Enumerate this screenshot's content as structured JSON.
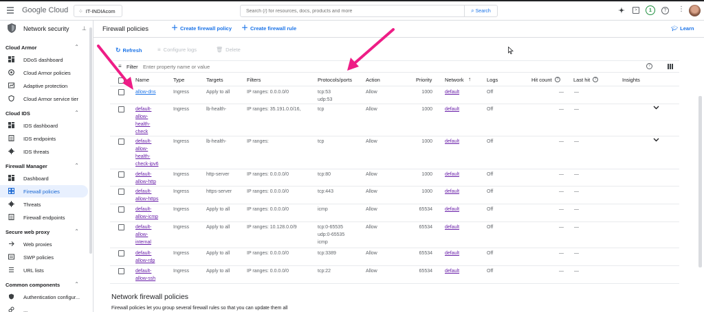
{
  "topbar": {
    "logo": "Google Cloud",
    "project": "IT-INDIAcom",
    "search_placeholder": "Search (/) for resources, docs, products and more",
    "search_button": "Search",
    "notification_count": "1"
  },
  "sidebar": {
    "title": "Network security",
    "sections": [
      {
        "header": "Cloud Armor",
        "items": [
          "DDoS dashboard",
          "Cloud Armor policies",
          "Adaptive protection",
          "Cloud Armor service tier"
        ]
      },
      {
        "header": "Cloud IDS",
        "items": [
          "IDS dashboard",
          "IDS endpoints",
          "IDS threats"
        ]
      },
      {
        "header": "Firewall Manager",
        "items": [
          "Dashboard",
          "Firewall policies",
          "Threats",
          "Firewall endpoints"
        ]
      },
      {
        "header": "Secure web proxy",
        "items": [
          "Web proxies",
          "SWP policies",
          "URL lists"
        ]
      },
      {
        "header": "Common components",
        "items": [
          "Authentication configur...",
          "..."
        ]
      }
    ]
  },
  "header": {
    "title": "Firewall policies",
    "create_policy": "Create firewall policy",
    "create_rule": "Create firewall rule",
    "learn": "Learn"
  },
  "toolbar": {
    "refresh": "Refresh",
    "configure_logs": "Configure logs",
    "delete": "Delete"
  },
  "filter": {
    "label": "Filter",
    "placeholder": "Enter property name or value"
  },
  "table": {
    "columns": [
      "Name",
      "Type",
      "Targets",
      "Filters",
      "Protocols/ports",
      "Action",
      "Priority",
      "Network",
      "Logs",
      "Hit count",
      "Last hit",
      "Insights"
    ],
    "rows": [
      {
        "name": [
          "allow-dns"
        ],
        "type": "Ingress",
        "targets": "Apply to all",
        "filters": "IP ranges: 0.0.0.0/0",
        "protocols": [
          "tcp:53",
          "udp:53"
        ],
        "action": "Allow",
        "priority": "1000",
        "network": "default",
        "logs": "Off",
        "hit": "—",
        "last": "—",
        "expand": false
      },
      {
        "name": [
          "default-",
          "allow-",
          "health-",
          "check"
        ],
        "type": "Ingress",
        "targets": "lb-health-",
        "filters": "IP ranges: 35.191.0.0/16,",
        "protocols": [
          "tcp"
        ],
        "action": "Allow",
        "priority": "1000",
        "network": "default",
        "logs": "Off",
        "hit": "—",
        "last": "—",
        "expand": true
      },
      {
        "name": [
          "default-",
          "allow-",
          "health-",
          "check-ipv6"
        ],
        "type": "Ingress",
        "targets": "lb-health-",
        "filters": "IP ranges:",
        "protocols": [
          "tcp"
        ],
        "action": "Allow",
        "priority": "1000",
        "network": "default",
        "logs": "Off",
        "hit": "—",
        "last": "—",
        "expand": true
      },
      {
        "name": [
          "default-",
          "allow-http"
        ],
        "type": "Ingress",
        "targets": "http-server",
        "filters": "IP ranges: 0.0.0.0/0",
        "protocols": [
          "tcp:80"
        ],
        "action": "Allow",
        "priority": "1000",
        "network": "default",
        "logs": "Off",
        "hit": "—",
        "last": "—",
        "expand": false
      },
      {
        "name": [
          "default-",
          "allow-https"
        ],
        "type": "Ingress",
        "targets": "https-server",
        "filters": "IP ranges: 0.0.0.0/0",
        "protocols": [
          "tcp:443"
        ],
        "action": "Allow",
        "priority": "1000",
        "network": "default",
        "logs": "Off",
        "hit": "—",
        "last": "—",
        "expand": false
      },
      {
        "name": [
          "default-",
          "allow-icmp"
        ],
        "type": "Ingress",
        "targets": "Apply to all",
        "filters": "IP ranges: 0.0.0.0/0",
        "protocols": [
          "icmp"
        ],
        "action": "Allow",
        "priority": "65534",
        "network": "default",
        "logs": "Off",
        "hit": "—",
        "last": "—",
        "expand": false
      },
      {
        "name": [
          "default-",
          "allow-",
          "internal"
        ],
        "type": "Ingress",
        "targets": "Apply to all",
        "filters": "IP ranges: 10.128.0.0/9",
        "protocols": [
          "tcp:0-65535",
          "udp:0-65535",
          "icmp"
        ],
        "action": "Allow",
        "priority": "65534",
        "network": "default",
        "logs": "Off",
        "hit": "—",
        "last": "—",
        "expand": false
      },
      {
        "name": [
          "default-",
          "allow-rdp"
        ],
        "type": "Ingress",
        "targets": "Apply to all",
        "filters": "IP ranges: 0.0.0.0/0",
        "protocols": [
          "tcp:3389"
        ],
        "action": "Allow",
        "priority": "65534",
        "network": "default",
        "logs": "Off",
        "hit": "—",
        "last": "—",
        "expand": false
      },
      {
        "name": [
          "default-",
          "allow-ssh"
        ],
        "type": "Ingress",
        "targets": "Apply to all",
        "filters": "IP ranges: 0.0.0.0/0",
        "protocols": [
          "tcp:22"
        ],
        "action": "Allow",
        "priority": "65534",
        "network": "default",
        "logs": "Off",
        "hit": "—",
        "last": "—",
        "expand": false
      }
    ]
  },
  "network_section": {
    "title": "Network firewall policies",
    "desc": "Firewall policies let you group several firewall rules so that you can update them all"
  },
  "colors": {
    "accent": "#1a73e8",
    "annotation_arrow": "#ee1d86",
    "visited_link": "#681da8"
  }
}
